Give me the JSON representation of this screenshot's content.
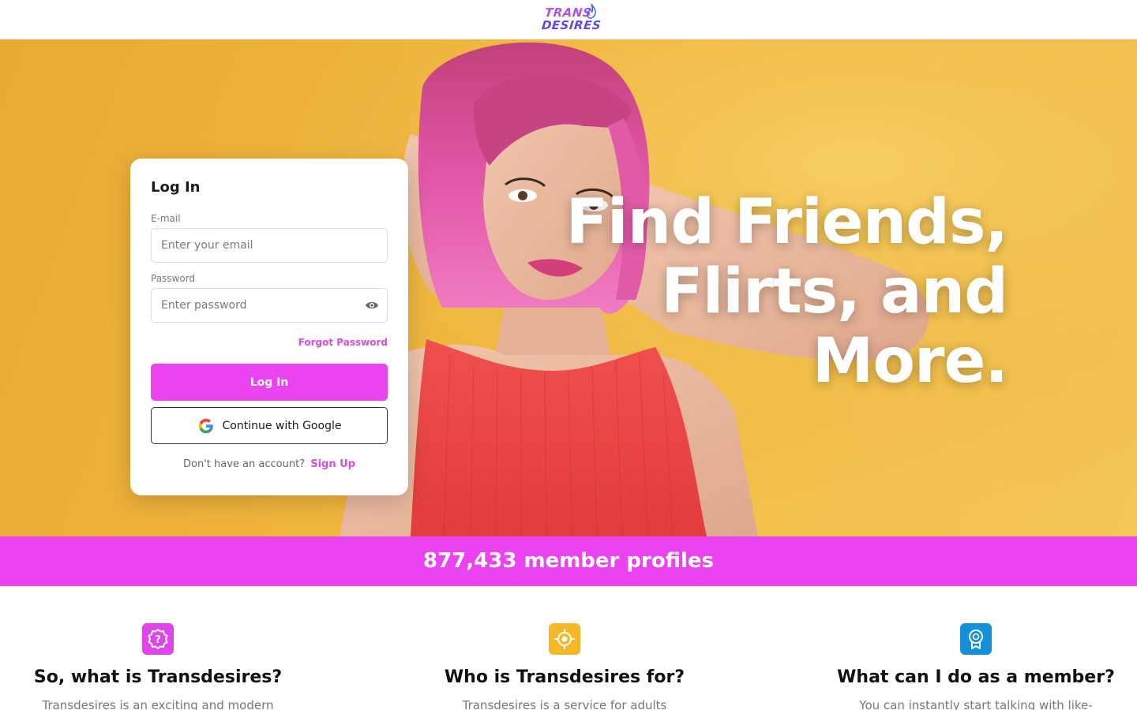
{
  "brand": {
    "logo_line1": "TRANS",
    "logo_line2": "DESIRES"
  },
  "hero": {
    "heading_line1": "Find Friends,",
    "heading_line2": "Flirts, and",
    "heading_line3": "More."
  },
  "login": {
    "title": "Log In",
    "email_label": "E-mail",
    "email_placeholder": "Enter your email",
    "password_label": "Password",
    "password_placeholder": "Enter password",
    "forgot_label": "Forgot Password",
    "login_button": "Log In",
    "google_button": "Continue with Google",
    "signup_prompt": "Don't have an account?",
    "signup_link": "Sign Up"
  },
  "members": {
    "text": "877,433 member profiles"
  },
  "features": [
    {
      "icon": "question-icon",
      "title": "So, what is Transdesires?",
      "text": "Transdesires is an exciting and modern"
    },
    {
      "icon": "target-icon",
      "title": "Who is Transdesires for?",
      "text": "Transdesires is a service for adults"
    },
    {
      "icon": "badge-icon",
      "title": "What can I do as a member?",
      "text": "You can instantly start talking with like-"
    }
  ],
  "colors": {
    "accent": "#ea43ef",
    "hero_bg": "#f0b53c",
    "feature_icon_1": "#e045ea",
    "feature_icon_2": "#f5b928",
    "feature_icon_3": "#1690d8"
  }
}
